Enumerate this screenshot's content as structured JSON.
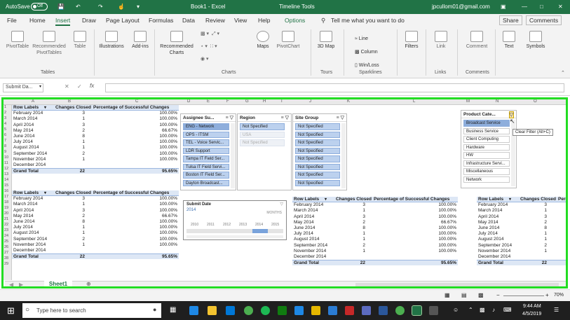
{
  "titlebar": {
    "autosave_label": "AutoSave",
    "autosave_state": "Off",
    "doc_title": "Book1 - Excel",
    "context_tab": "Timeline Tools",
    "user_email": "jpcullom01@gmail.com"
  },
  "tabs": [
    {
      "label": "File"
    },
    {
      "label": "Home"
    },
    {
      "label": "Insert"
    },
    {
      "label": "Draw"
    },
    {
      "label": "Page Layout"
    },
    {
      "label": "Formulas"
    },
    {
      "label": "Data"
    },
    {
      "label": "Review"
    },
    {
      "label": "View"
    },
    {
      "label": "Help"
    },
    {
      "label": "Options"
    }
  ],
  "tell_me": "Tell me what you want to do",
  "share": "Share",
  "comments": "Comments",
  "ribbon": {
    "pivottable": "PivotTable",
    "recommended_pivot": "Recommended PivotTables",
    "table": "Table",
    "illustrations": "Illustrations",
    "addins": "Add-ins",
    "recommended_charts": "Recommended Charts",
    "maps": "Maps",
    "pivotchart": "PivotChart",
    "map3d": "3D Map",
    "line": "Line",
    "column": "Column",
    "winloss": "Win/Loss",
    "filters": "Filters",
    "link": "Link",
    "comment": "Comment",
    "text": "Text",
    "symbols": "Symbols",
    "groups": {
      "tables": "Tables",
      "charts": "Charts",
      "tours": "Tours",
      "sparklines": "Sparklines",
      "links": "Links",
      "comments": "Comments"
    }
  },
  "namebox": "Submit Da...",
  "columns": [
    "A",
    "B",
    "C",
    "D",
    "E",
    "F",
    "G",
    "H",
    "I",
    "J",
    "K",
    "L",
    "M",
    "N",
    "O"
  ],
  "rows": [
    "1",
    "2",
    "3",
    "4",
    "5",
    "6",
    "7",
    "8",
    "9",
    "10",
    "11",
    "12",
    "13",
    "14",
    "15",
    "16",
    "17",
    "18",
    "19",
    "20",
    "21",
    "22",
    "23",
    "24",
    "25",
    "26",
    "27",
    "28",
    "29"
  ],
  "pivot": {
    "headers": [
      "Row Labels",
      "Changes Closed",
      "Percentage of Successful Changes"
    ],
    "rows": [
      [
        "February 2014",
        "3",
        "100.00%"
      ],
      [
        "March 2014",
        "1",
        "100.00%"
      ],
      [
        "April 2014",
        "3",
        "100.00%"
      ],
      [
        "May 2014",
        "2",
        "66.67%"
      ],
      [
        "June 2014",
        "8",
        "100.00%"
      ],
      [
        "July 2014",
        "1",
        "100.00%"
      ],
      [
        "August 2014",
        "1",
        "100.00%"
      ],
      [
        "September 2014",
        "2",
        "100.00%"
      ],
      [
        "November 2014",
        "1",
        "100.00%"
      ],
      [
        "December 2014",
        "",
        ""
      ]
    ],
    "total": [
      "Grand Total",
      "22",
      "95.65%"
    ]
  },
  "slicers": {
    "assignee": {
      "title": "Assignee Su...",
      "items": [
        "ENG - Network",
        "OPS - ITSM",
        "TEL - Voice Servic...",
        "LDR Support",
        "Tampa IT Field Ser...",
        "Tulsa IT Field Servi...",
        "Boston IT Field Ser...",
        "Dayton Broadcast..."
      ]
    },
    "region": {
      "title": "Region",
      "items": [
        "Not Specified",
        "USA",
        "Not Specified"
      ]
    },
    "site": {
      "title": "Site Group",
      "items": [
        "Not Specified",
        "Not Specified",
        "Not Specified",
        "Not Specified",
        "Not Specified",
        "Not Specified",
        "Not Specified",
        "Not Specified"
      ]
    },
    "product": {
      "title": "Product Cate...",
      "items": [
        "Broadcast Service",
        "Business Service",
        "Client Computing",
        "Hardware",
        "HW",
        "Infrastructure Servi...",
        "Miscellaneous",
        "Network"
      ]
    }
  },
  "tooltip": "Clear Filter (Alt+C)",
  "timeline": {
    "title": "Submit Date",
    "year": "2014",
    "unit": "MONTHS",
    "ticks": [
      "2010",
      "2011",
      "2012",
      "2013",
      "2014",
      "2015"
    ]
  },
  "sheet_tab": "Sheet1",
  "status": {
    "zoom": "70%"
  },
  "taskbar": {
    "search": "Type here to search",
    "time": "9:44 AM",
    "date": "4/5/2019"
  }
}
